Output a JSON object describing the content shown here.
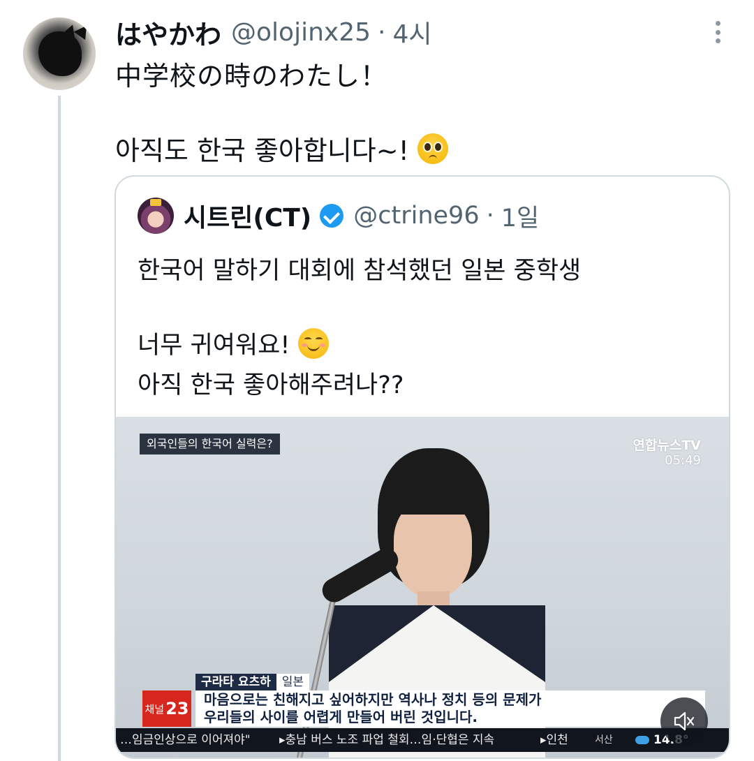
{
  "tweet": {
    "display_name": "はやかわ",
    "handle": "@olojinx25",
    "separator": "·",
    "time": "4시",
    "text_line1": "中学校の時のわたし！",
    "text_line2": "아직도 한국 좋아합니다~!",
    "emoji": "pleading-face-icon"
  },
  "quoted_tweet": {
    "display_name": "시트린(CT)",
    "verified": true,
    "handle": "@ctrine96",
    "separator": "·",
    "time": "1일",
    "line1": "한국어 말하기 대회에 참석했던 일본 중학생",
    "line2": "너무 귀여워요!",
    "line3": "아직 한국 좋아해주려나??",
    "emoji": "smiling-face-icon"
  },
  "video": {
    "topic": "외국인들의 한국어 실력은?",
    "logo": "연합뉴스TV",
    "clock": "05:49",
    "speaker_name": "구라타 요츠하",
    "speaker_country": "일본",
    "channel_word": "채널",
    "channel_number": "23",
    "subtitle_line1": "마음으로는 친해지고 싶어하지만 역사나 정치 등의 문제가",
    "subtitle_line2": "우리들의 사이를 어렵게 만들어 버린 것입니다.",
    "ticker_1": "…임금인상으로 이어져야\"",
    "ticker_2": "▸충남 버스 노조 파업 철회…임·단협은 지속",
    "ticker_3": "▸인천",
    "weather_city": "서산",
    "weather_temp": "14.8°",
    "mute_icon": "muted-speaker-icon"
  },
  "colors": {
    "text_primary": "#0f1419",
    "text_secondary": "#536471",
    "border": "#cfd9de",
    "verified_blue": "#1d9bf0",
    "channel_red": "#d7261e"
  }
}
